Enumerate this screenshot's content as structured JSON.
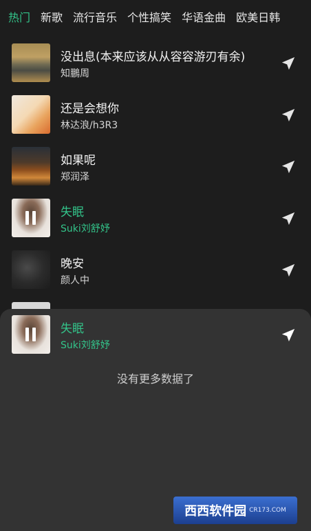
{
  "tabs": [
    "热门",
    "新歌",
    "流行音乐",
    "个性搞笑",
    "华语金曲",
    "欧美日韩"
  ],
  "songs": [
    {
      "title": "没出息(本来应该从从容容游刃有余)",
      "artist": "知鵬周"
    },
    {
      "title": "还是会想你",
      "artist": "林达浪/h3R3"
    },
    {
      "title": "如果呢",
      "artist": "郑润泽"
    },
    {
      "title": "失眠",
      "artist": "Suki刘舒妤"
    },
    {
      "title": "晚安",
      "artist": "颜人中"
    }
  ],
  "now_playing": {
    "title": "失眠",
    "artist": "Suki刘舒妤"
  },
  "sheet_message": "没有更多数据了",
  "colors": {
    "accent": "#33c48a",
    "background": "#1d1d1d",
    "sheet": "#333333"
  },
  "icons": {
    "send": "send-icon",
    "pause": "pause-icon"
  },
  "watermark": {
    "logo": "西西软件园",
    "url": "CR173.COM"
  }
}
